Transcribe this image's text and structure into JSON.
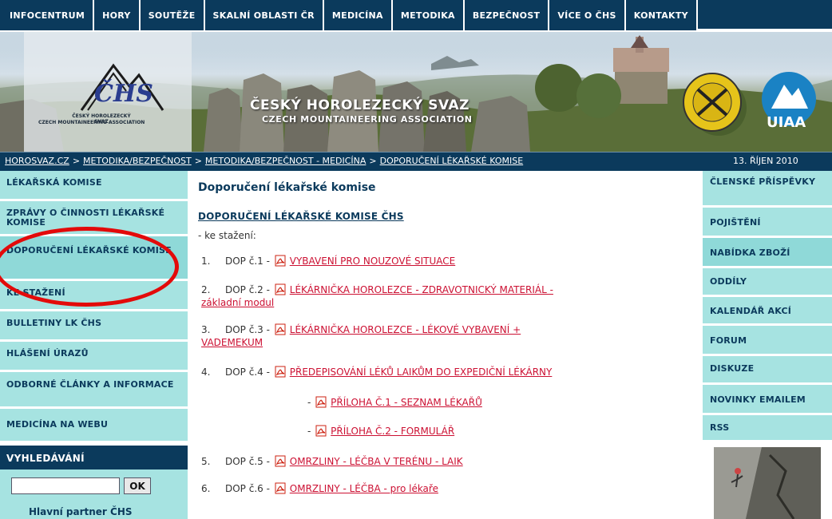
{
  "topnav": {
    "items": [
      "INFOCENTRUM",
      "HORY",
      "SOUTĚŽE",
      "SKALNÍ OBLASTI ČR",
      "MEDICÍNA",
      "METODIKA",
      "BEZPEČNOST",
      "VÍCE O ČHS",
      "KONTAKTY"
    ]
  },
  "banner": {
    "logo_letters": "ČHS",
    "logo_line1": "ČESKÝ HOROLEZECKÝ SVAZ",
    "logo_line2": "CZECH MOUNTAINEERING ASSOCIATION",
    "title": "ČESKÝ HOROLEZECKÝ SVAZ",
    "subtitle": "CZECH MOUNTAINEERING ASSOCIATION",
    "uiaa": "UIAA"
  },
  "breadcrumb": {
    "items": [
      "HOROSVAZ.CZ",
      "METODIKA/BEZPEČNOST",
      "METODIKA/BEZPEČNOST - MEDICÍNA",
      "DOPORUČENÍ LÉKAŘSKÉ KOMISE"
    ],
    "separator": ">",
    "date": "13. ŘÍJEN 2010"
  },
  "leftnav": {
    "items": [
      "LÉKAŘSKÁ KOMISE",
      "ZPRÁVY O ČINNOSTI LÉKAŘSKÉ KOMISE",
      "DOPORUČENÍ LÉKAŘSKÉ KOMISE",
      "KE STAŽENÍ",
      "BULLETINY LK ČHS",
      "HLÁŠENÍ ÚRAZŮ",
      "ODBORNÉ ČLÁNKY A INFORMACE",
      "MEDICÍNA NA WEBU"
    ],
    "search_heading": "VYHLEDÁVÁNÍ",
    "search_value": "",
    "search_button": "OK",
    "partner": "Hlavní partner ČHS"
  },
  "main": {
    "title": "Doporučení lékařské komise",
    "subheading": "DOPORUČENÍ LÉKAŘSKÉ KOMISE ČHS",
    "download_label": "- ke stažení:",
    "docs": [
      {
        "num": "1.",
        "prefix": "DOP č.1 -",
        "link": "VYBAVENÍ PRO NOUZOVÉ SITUACE",
        "cont": ""
      },
      {
        "num": "2.",
        "prefix": "DOP č.2 -",
        "link": "LÉKÁRNIČKA HOROLEZCE - ZDRAVOTNICKÝ MATERIÁL -",
        "cont": "základní modul"
      },
      {
        "num": "3.",
        "prefix": "DOP č.3 -",
        "link": "LÉKÁRNIČKA HOROLEZCE - LÉKOVÉ VYBAVENÍ +",
        "cont": "VADEMEKUM"
      },
      {
        "num": "4.",
        "prefix": "DOP č.4 -",
        "link": "PŘEDEPISOVÁNÍ LÉKŮ LAIKŮM DO EXPEDIČNÍ LÉKÁRNY",
        "cont": ""
      },
      {
        "num": "5.",
        "prefix": "DOP č.5 -",
        "link": "OMRZLINY - LÉČBA V TERÉNU - LAIK",
        "cont": ""
      },
      {
        "num": "6.",
        "prefix": "DOP č.6 -",
        "link": "OMRZLINY - LÉČBA - pro lékaře",
        "cont": ""
      }
    ],
    "attachments": [
      {
        "prefix": "-",
        "link": "PŘÍLOHA Č.1 - SEZNAM LÉKAŘŮ"
      },
      {
        "prefix": "-",
        "link": "PŘÍLOHA Č.2 - FORMULÁŘ"
      }
    ]
  },
  "rightnav": {
    "items": [
      "ČLENSKÉ PŘÍSPĚVKY",
      "POJIŠTĚNÍ",
      "NABÍDKA ZBOŽÍ",
      "ODDÍLY",
      "KALENDÁŘ AKCÍ",
      "FORUM",
      "DISKUZE",
      "NOVINKY EMAILEM",
      "RSS"
    ]
  },
  "colors": {
    "navy": "#0b3a5c",
    "teal": "#a6e3e1",
    "link_red": "#cc1133",
    "annotation_red": "#e30a0a"
  }
}
